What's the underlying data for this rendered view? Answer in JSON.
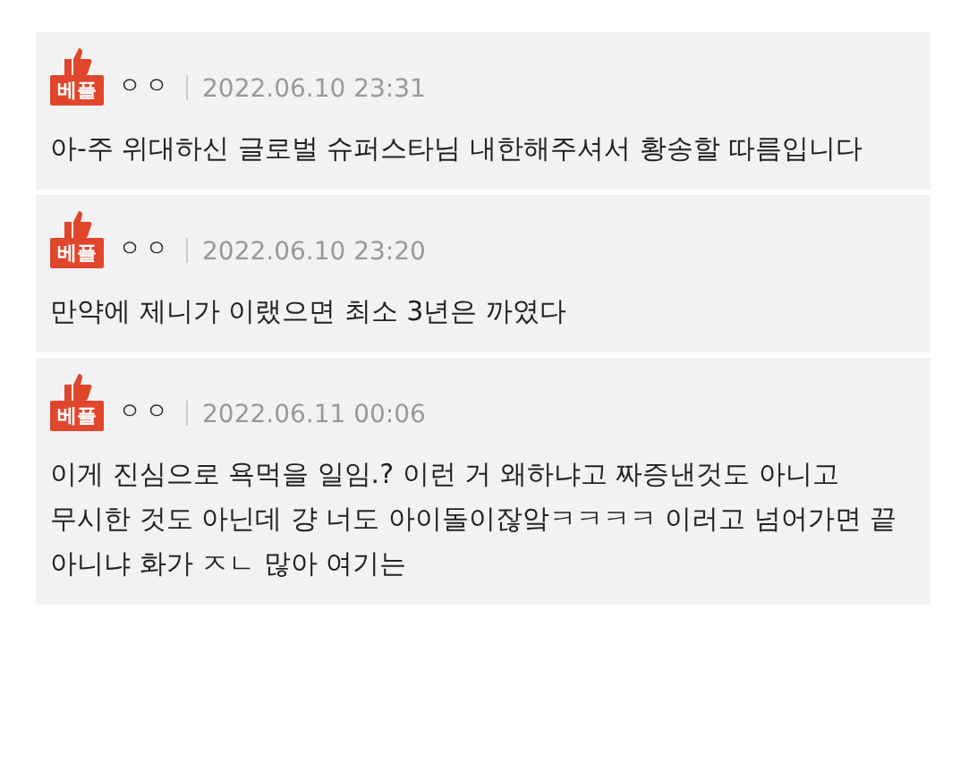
{
  "comments": [
    {
      "badge": "베플",
      "author": "ㅇㅇ",
      "date": "2022.06.10 23:31",
      "text": "아-주 위대하신 글로벌 슈퍼스타님 내한해주셔서 황송할 따름입니다"
    },
    {
      "badge": "베플",
      "author": "ㅇㅇ",
      "date": "2022.06.10 23:20",
      "text": "만약에 제니가 이랬으면 최소 3년은 까였다"
    },
    {
      "badge": "베플",
      "author": "ㅇㅇ",
      "date": "2022.06.11 00:06",
      "text": "이게 진심으로 욕먹을 일임.? 이런 거 왜하냐고 짜증낸것도 아니고 무시한 것도 아닌데 걍 너도 아이돌이잖앜ㅋㅋㅋㅋ 이러고 넘어가면 끝 아니냐 화가 ㅈㄴ 많아 여기는"
    }
  ]
}
